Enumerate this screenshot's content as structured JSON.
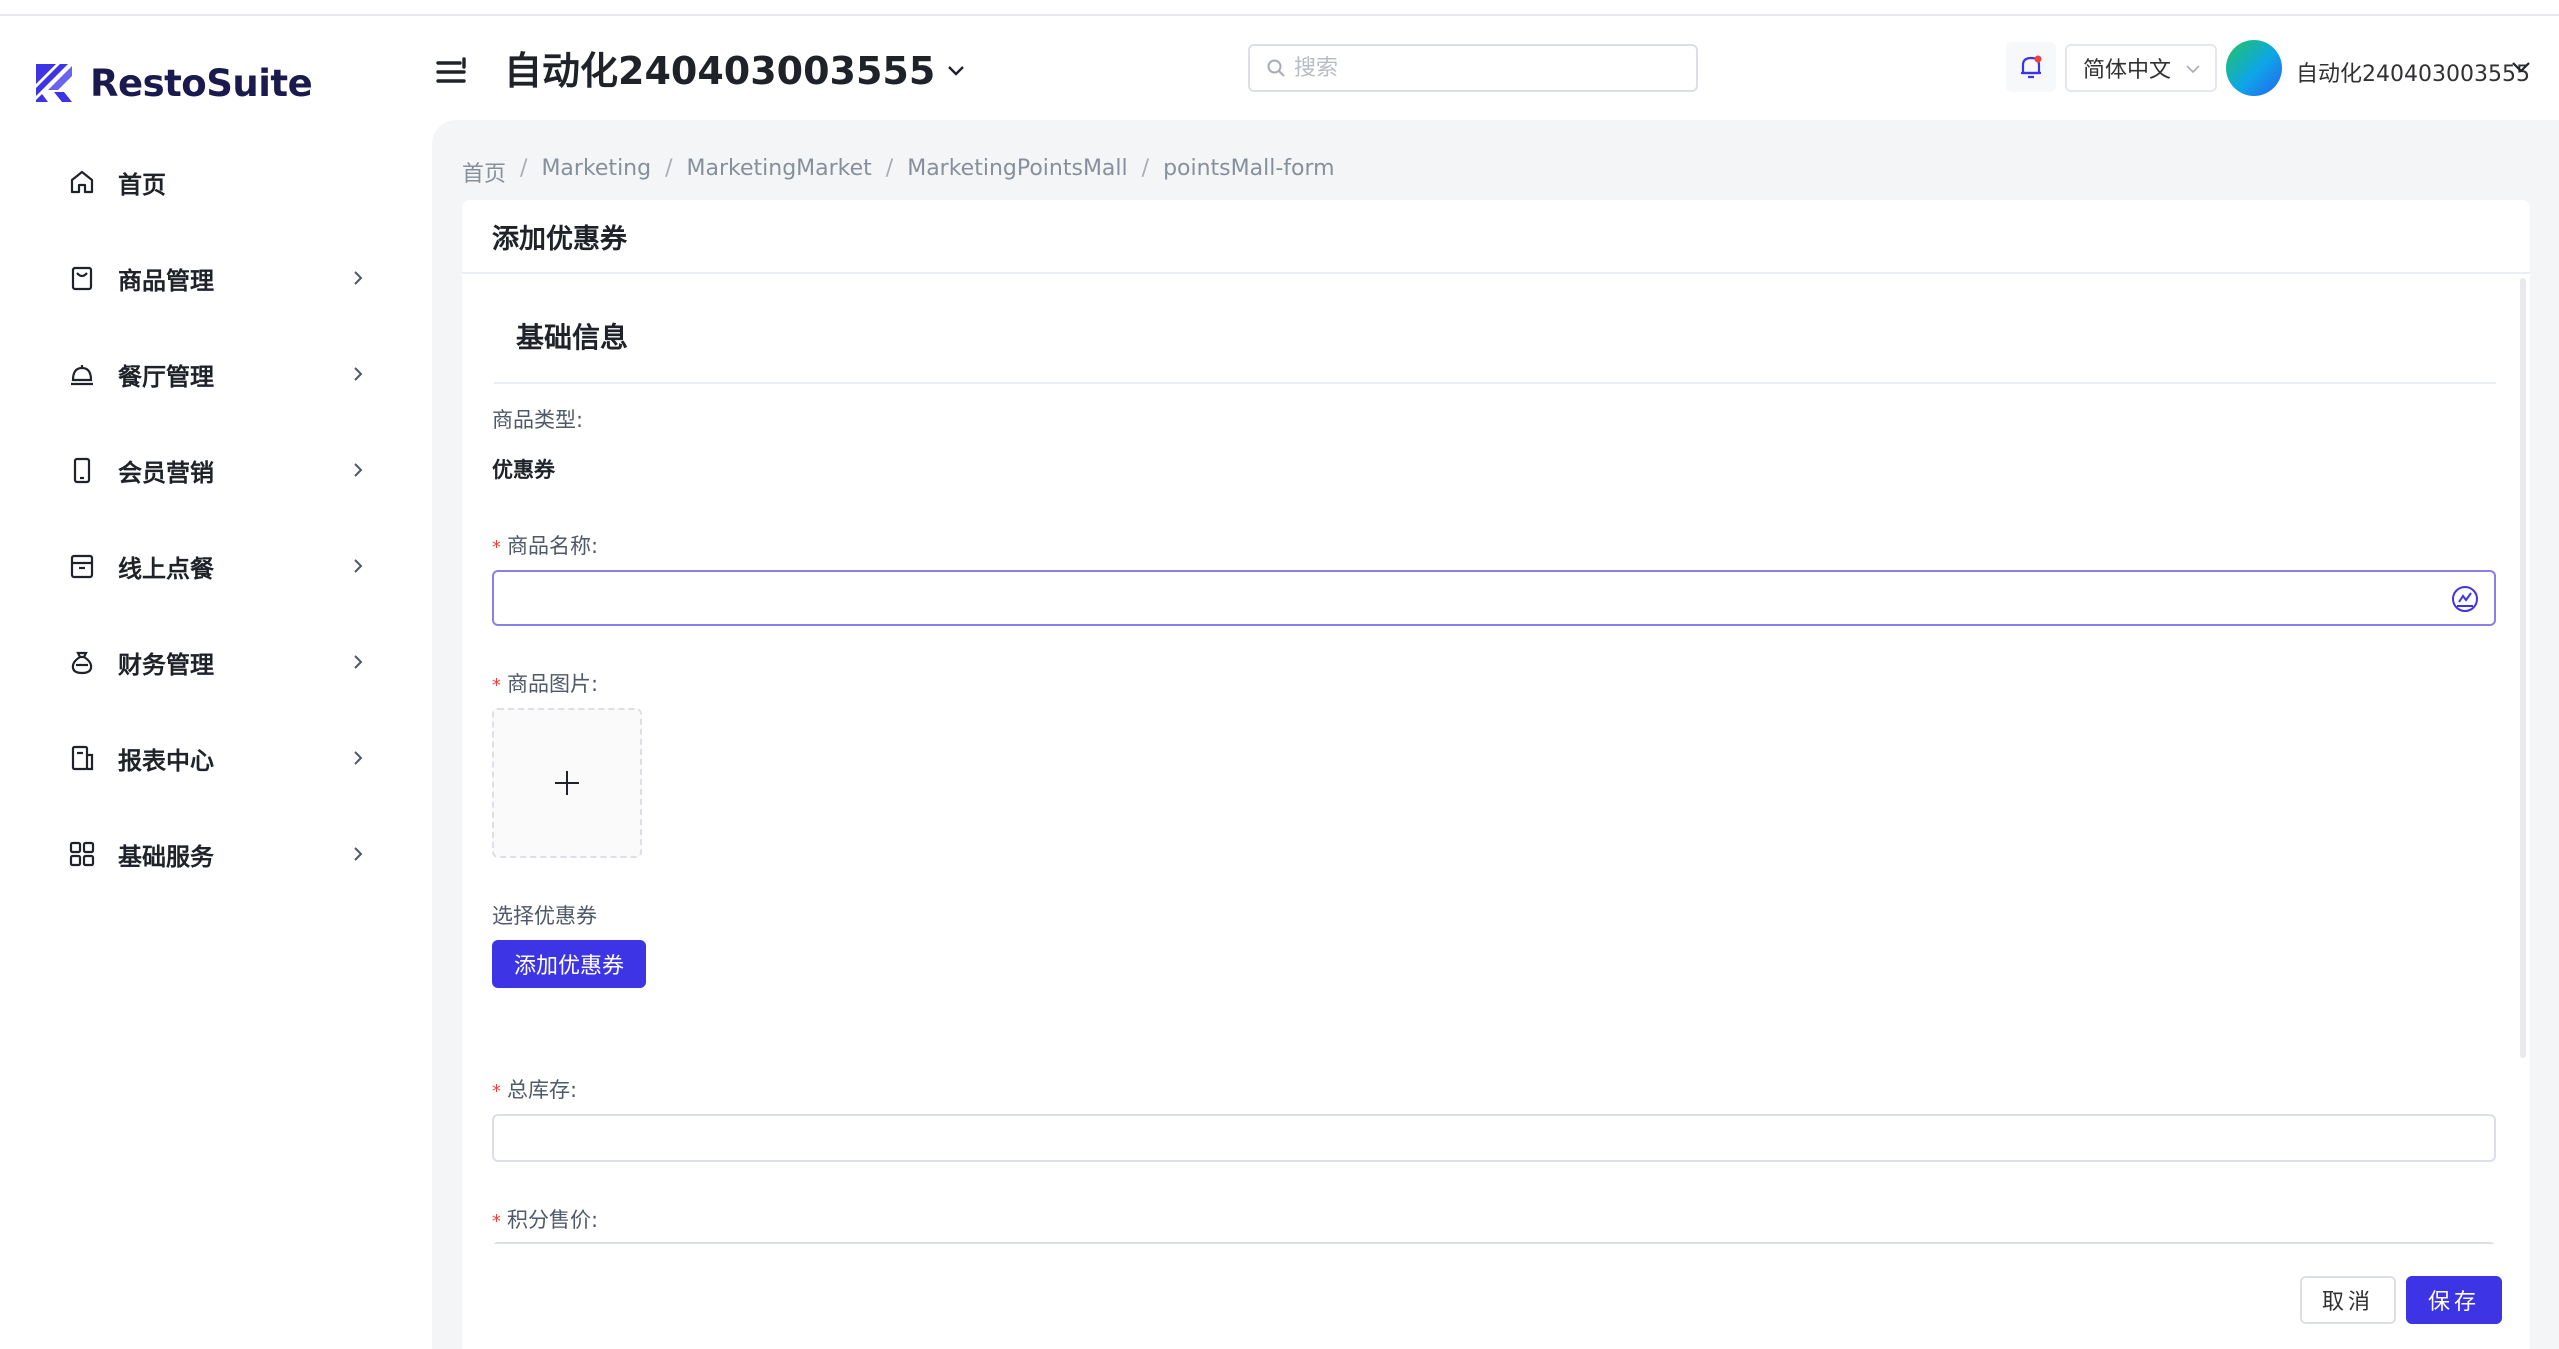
{
  "brand": {
    "name": "RestoSuite",
    "accent": "#3d35e5"
  },
  "sidebar": {
    "items": [
      {
        "label": "首页",
        "icon": "home-icon",
        "has_children": false
      },
      {
        "label": "商品管理",
        "icon": "bag-icon",
        "has_children": true
      },
      {
        "label": "餐厅管理",
        "icon": "cloche-icon",
        "has_children": true
      },
      {
        "label": "会员营销",
        "icon": "phone-icon",
        "has_children": true
      },
      {
        "label": "线上点餐",
        "icon": "store-box-icon",
        "has_children": true
      },
      {
        "label": "财务管理",
        "icon": "money-bag-icon",
        "has_children": true
      },
      {
        "label": "报表中心",
        "icon": "report-icon",
        "has_children": true
      },
      {
        "label": "基础服务",
        "icon": "grid-icon",
        "has_children": true
      }
    ]
  },
  "header": {
    "store_name": "自动化240403003555",
    "search_placeholder": "搜索",
    "language": "简体中文",
    "username": "自动化240403003555"
  },
  "breadcrumb": [
    "首页",
    "Marketing",
    "MarketingMarket",
    "MarketingPointsMall",
    "pointsMall-form"
  ],
  "page": {
    "title": "添加优惠券",
    "section_title": "基础信息",
    "fields": {
      "product_type_label": "商品类型:",
      "product_type_value": "优惠券",
      "product_name_label": "商品名称:",
      "product_name_value": "",
      "product_image_label": "商品图片:",
      "select_coupon_label": "选择优惠券",
      "add_coupon_button": "添加优惠券",
      "total_stock_label": "总库存:",
      "total_stock_value": "",
      "points_price_label": "积分售价:"
    },
    "required_mark": "*",
    "footer": {
      "cancel": "取消",
      "save": "保存"
    }
  }
}
